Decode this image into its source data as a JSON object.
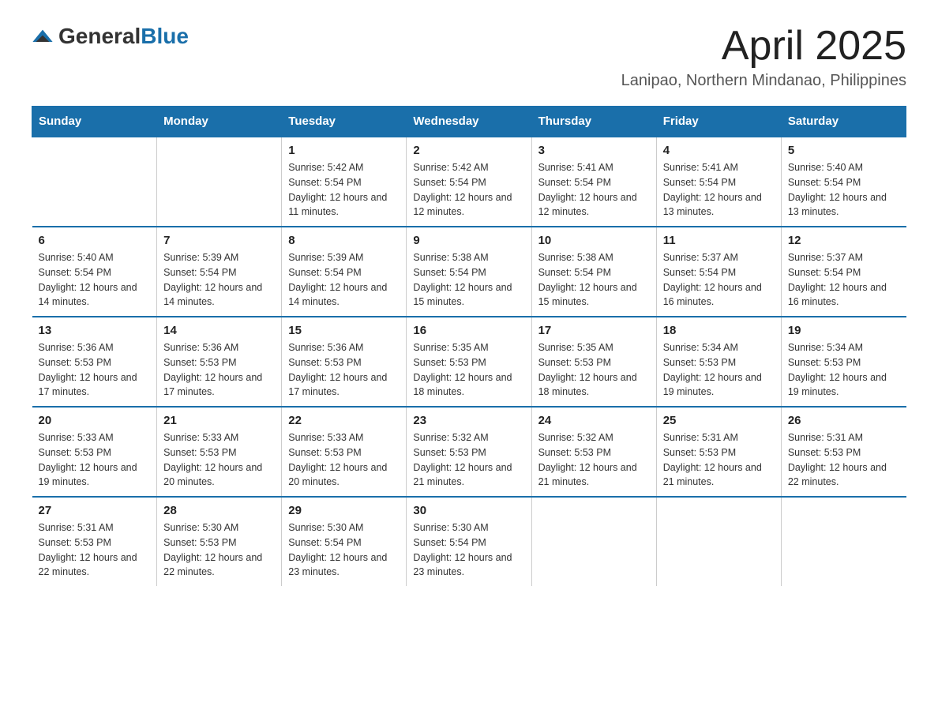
{
  "header": {
    "logo_general": "General",
    "logo_blue": "Blue",
    "month_title": "April 2025",
    "location": "Lanipao, Northern Mindanao, Philippines"
  },
  "weekdays": [
    "Sunday",
    "Monday",
    "Tuesday",
    "Wednesday",
    "Thursday",
    "Friday",
    "Saturday"
  ],
  "weeks": [
    [
      {
        "day": "",
        "sunrise": "",
        "sunset": "",
        "daylight": ""
      },
      {
        "day": "",
        "sunrise": "",
        "sunset": "",
        "daylight": ""
      },
      {
        "day": "1",
        "sunrise": "Sunrise: 5:42 AM",
        "sunset": "Sunset: 5:54 PM",
        "daylight": "Daylight: 12 hours and 11 minutes."
      },
      {
        "day": "2",
        "sunrise": "Sunrise: 5:42 AM",
        "sunset": "Sunset: 5:54 PM",
        "daylight": "Daylight: 12 hours and 12 minutes."
      },
      {
        "day": "3",
        "sunrise": "Sunrise: 5:41 AM",
        "sunset": "Sunset: 5:54 PM",
        "daylight": "Daylight: 12 hours and 12 minutes."
      },
      {
        "day": "4",
        "sunrise": "Sunrise: 5:41 AM",
        "sunset": "Sunset: 5:54 PM",
        "daylight": "Daylight: 12 hours and 13 minutes."
      },
      {
        "day": "5",
        "sunrise": "Sunrise: 5:40 AM",
        "sunset": "Sunset: 5:54 PM",
        "daylight": "Daylight: 12 hours and 13 minutes."
      }
    ],
    [
      {
        "day": "6",
        "sunrise": "Sunrise: 5:40 AM",
        "sunset": "Sunset: 5:54 PM",
        "daylight": "Daylight: 12 hours and 14 minutes."
      },
      {
        "day": "7",
        "sunrise": "Sunrise: 5:39 AM",
        "sunset": "Sunset: 5:54 PM",
        "daylight": "Daylight: 12 hours and 14 minutes."
      },
      {
        "day": "8",
        "sunrise": "Sunrise: 5:39 AM",
        "sunset": "Sunset: 5:54 PM",
        "daylight": "Daylight: 12 hours and 14 minutes."
      },
      {
        "day": "9",
        "sunrise": "Sunrise: 5:38 AM",
        "sunset": "Sunset: 5:54 PM",
        "daylight": "Daylight: 12 hours and 15 minutes."
      },
      {
        "day": "10",
        "sunrise": "Sunrise: 5:38 AM",
        "sunset": "Sunset: 5:54 PM",
        "daylight": "Daylight: 12 hours and 15 minutes."
      },
      {
        "day": "11",
        "sunrise": "Sunrise: 5:37 AM",
        "sunset": "Sunset: 5:54 PM",
        "daylight": "Daylight: 12 hours and 16 minutes."
      },
      {
        "day": "12",
        "sunrise": "Sunrise: 5:37 AM",
        "sunset": "Sunset: 5:54 PM",
        "daylight": "Daylight: 12 hours and 16 minutes."
      }
    ],
    [
      {
        "day": "13",
        "sunrise": "Sunrise: 5:36 AM",
        "sunset": "Sunset: 5:53 PM",
        "daylight": "Daylight: 12 hours and 17 minutes."
      },
      {
        "day": "14",
        "sunrise": "Sunrise: 5:36 AM",
        "sunset": "Sunset: 5:53 PM",
        "daylight": "Daylight: 12 hours and 17 minutes."
      },
      {
        "day": "15",
        "sunrise": "Sunrise: 5:36 AM",
        "sunset": "Sunset: 5:53 PM",
        "daylight": "Daylight: 12 hours and 17 minutes."
      },
      {
        "day": "16",
        "sunrise": "Sunrise: 5:35 AM",
        "sunset": "Sunset: 5:53 PM",
        "daylight": "Daylight: 12 hours and 18 minutes."
      },
      {
        "day": "17",
        "sunrise": "Sunrise: 5:35 AM",
        "sunset": "Sunset: 5:53 PM",
        "daylight": "Daylight: 12 hours and 18 minutes."
      },
      {
        "day": "18",
        "sunrise": "Sunrise: 5:34 AM",
        "sunset": "Sunset: 5:53 PM",
        "daylight": "Daylight: 12 hours and 19 minutes."
      },
      {
        "day": "19",
        "sunrise": "Sunrise: 5:34 AM",
        "sunset": "Sunset: 5:53 PM",
        "daylight": "Daylight: 12 hours and 19 minutes."
      }
    ],
    [
      {
        "day": "20",
        "sunrise": "Sunrise: 5:33 AM",
        "sunset": "Sunset: 5:53 PM",
        "daylight": "Daylight: 12 hours and 19 minutes."
      },
      {
        "day": "21",
        "sunrise": "Sunrise: 5:33 AM",
        "sunset": "Sunset: 5:53 PM",
        "daylight": "Daylight: 12 hours and 20 minutes."
      },
      {
        "day": "22",
        "sunrise": "Sunrise: 5:33 AM",
        "sunset": "Sunset: 5:53 PM",
        "daylight": "Daylight: 12 hours and 20 minutes."
      },
      {
        "day": "23",
        "sunrise": "Sunrise: 5:32 AM",
        "sunset": "Sunset: 5:53 PM",
        "daylight": "Daylight: 12 hours and 21 minutes."
      },
      {
        "day": "24",
        "sunrise": "Sunrise: 5:32 AM",
        "sunset": "Sunset: 5:53 PM",
        "daylight": "Daylight: 12 hours and 21 minutes."
      },
      {
        "day": "25",
        "sunrise": "Sunrise: 5:31 AM",
        "sunset": "Sunset: 5:53 PM",
        "daylight": "Daylight: 12 hours and 21 minutes."
      },
      {
        "day": "26",
        "sunrise": "Sunrise: 5:31 AM",
        "sunset": "Sunset: 5:53 PM",
        "daylight": "Daylight: 12 hours and 22 minutes."
      }
    ],
    [
      {
        "day": "27",
        "sunrise": "Sunrise: 5:31 AM",
        "sunset": "Sunset: 5:53 PM",
        "daylight": "Daylight: 12 hours and 22 minutes."
      },
      {
        "day": "28",
        "sunrise": "Sunrise: 5:30 AM",
        "sunset": "Sunset: 5:53 PM",
        "daylight": "Daylight: 12 hours and 22 minutes."
      },
      {
        "day": "29",
        "sunrise": "Sunrise: 5:30 AM",
        "sunset": "Sunset: 5:54 PM",
        "daylight": "Daylight: 12 hours and 23 minutes."
      },
      {
        "day": "30",
        "sunrise": "Sunrise: 5:30 AM",
        "sunset": "Sunset: 5:54 PM",
        "daylight": "Daylight: 12 hours and 23 minutes."
      },
      {
        "day": "",
        "sunrise": "",
        "sunset": "",
        "daylight": ""
      },
      {
        "day": "",
        "sunrise": "",
        "sunset": "",
        "daylight": ""
      },
      {
        "day": "",
        "sunrise": "",
        "sunset": "",
        "daylight": ""
      }
    ]
  ]
}
